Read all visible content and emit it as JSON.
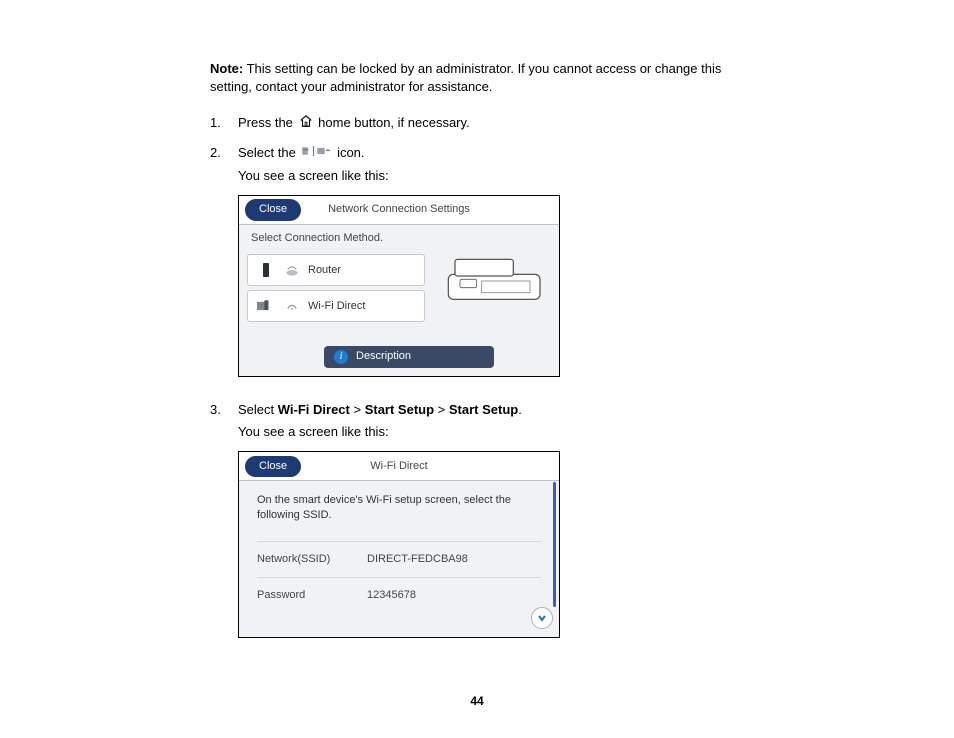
{
  "note_label": "Note:",
  "note_text": " This setting can be locked by an administrator. If you cannot access or change this setting, contact your administrator for assistance.",
  "steps": {
    "1": {
      "num": "1.",
      "pre": "Press the ",
      "post": " home button, if necessary."
    },
    "2": {
      "num": "2.",
      "pre": "Select the ",
      "post": " icon.",
      "follow": "You see a screen like this:"
    },
    "3": {
      "num": "3.",
      "pre": "Select ",
      "b1": "Wi-Fi Direct",
      "gt1": " > ",
      "b2": "Start Setup",
      "gt2": " > ",
      "b3": "Start Setup",
      "period": ".",
      "follow": "You see a screen like this:"
    }
  },
  "screen1": {
    "close": "Close",
    "title": "Network Connection Settings",
    "subtitle": "Select Connection Method.",
    "opt_router": "Router",
    "opt_wifidirect": "Wi-Fi Direct",
    "description": "Description"
  },
  "screen2": {
    "close": "Close",
    "title": "Wi-Fi Direct",
    "msg": "On the smart device's Wi-Fi setup screen, select the following SSID.",
    "k_ssid": "Network(SSID)",
    "v_ssid": "DIRECT-FEDCBA98",
    "k_pw": "Password",
    "v_pw": "12345678"
  },
  "page_number": "44"
}
